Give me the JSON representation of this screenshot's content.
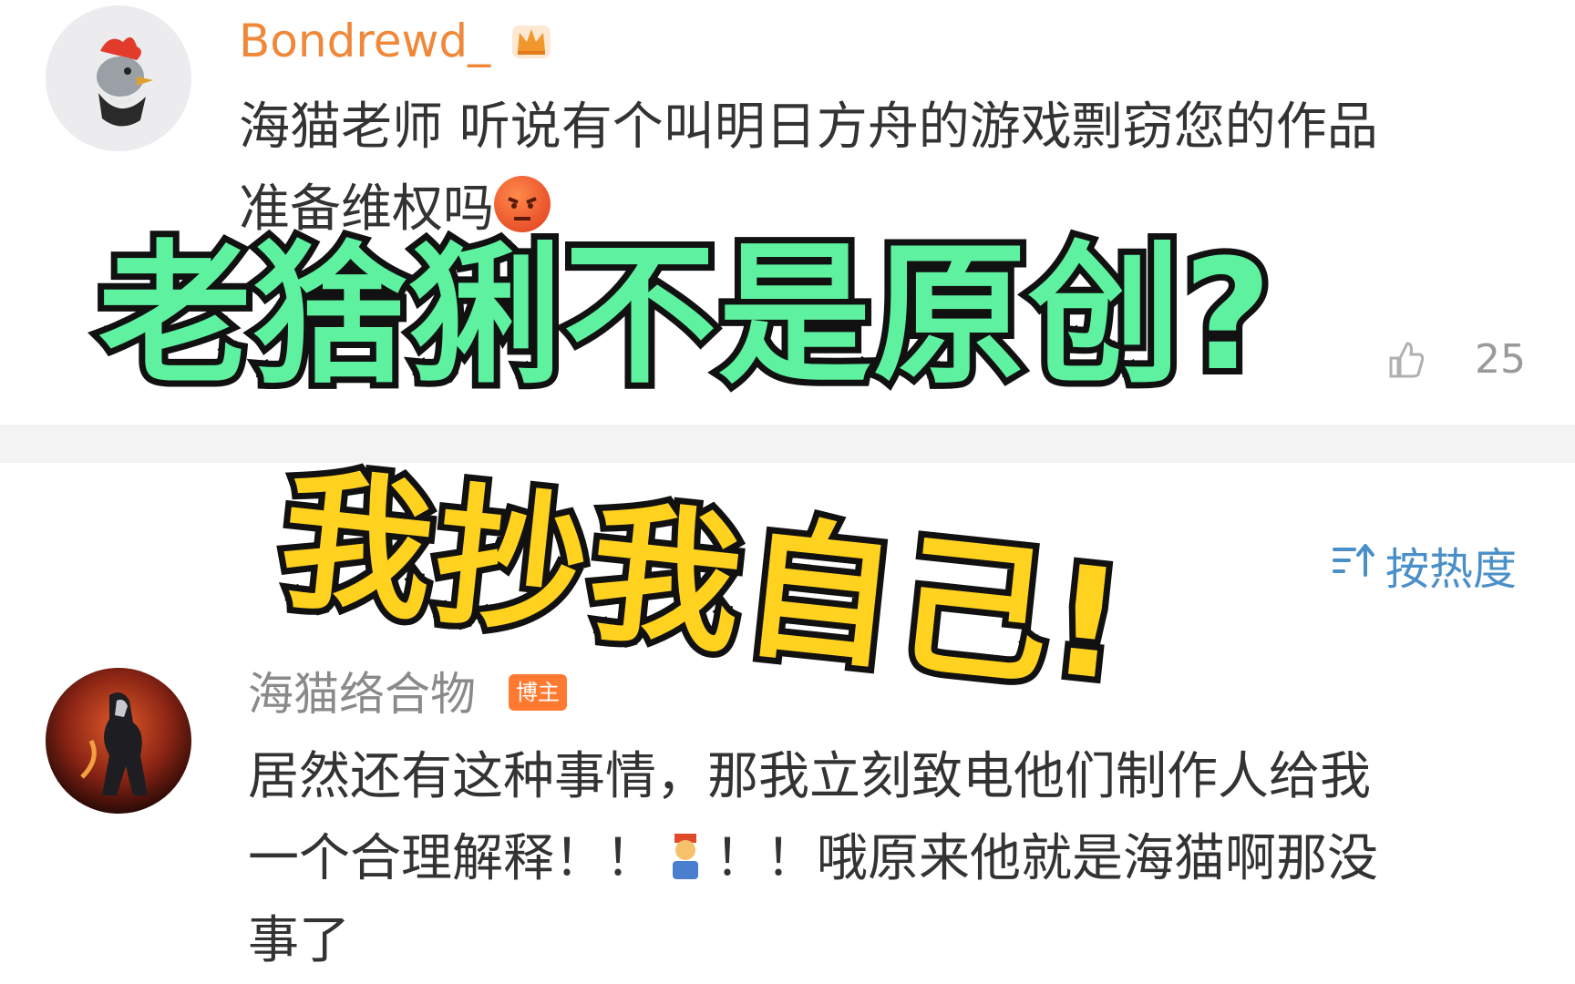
{
  "colors": {
    "username_orange": "#f0883a",
    "username_gray": "#8a8a8a",
    "body_text": "#333333",
    "sort_blue": "#4a8fc8",
    "badge_orange": "#ff7a30",
    "headline_green": "#5ef2a0",
    "subline_yellow": "#ffd21f",
    "divider": "#f3f3f4"
  },
  "comments": [
    {
      "username": "Bondrewd_",
      "badge_icon": "crown-icon",
      "text_line1": "海猫老师 听说有个叫明日方舟的游戏剽窃您的作品",
      "text_line2": "准备维权吗",
      "emoji": "angry-face-icon",
      "like_count": "25"
    },
    {
      "username": "海猫络合物",
      "badge": "博主",
      "text_line1": "居然还有这种事情，那我立刻致电他们制作人给我",
      "text_line2a": "一个合理解释！！",
      "emoji": "person-emoji-icon",
      "text_line2b": "！！哦原来他就是海猫啊那没",
      "text_line3": "事了"
    }
  ],
  "sort": {
    "icon": "sort-icon",
    "label": "按热度"
  },
  "overlay": {
    "headline": "老猞猁不是原创?",
    "subline": "我抄我自己!"
  }
}
